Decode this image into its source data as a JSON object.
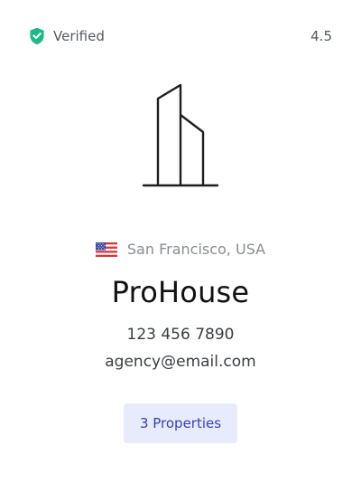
{
  "header": {
    "verified_label": "Verified",
    "verified_icon": "shield-check-icon",
    "rating": "4.5"
  },
  "logo": {
    "icon": "building-icon"
  },
  "location": {
    "flag_icon": "us-flag-icon",
    "text": "San Francisco, USA"
  },
  "agency": {
    "name": "ProHouse",
    "phone": "123 456 7890",
    "email": "agency@email.com"
  },
  "actions": {
    "properties_label": "3 Properties"
  },
  "colors": {
    "verified_green": "#1db98a",
    "button_bg": "#e8ebfc",
    "button_text": "#3343b8",
    "text_muted": "#8a8d92",
    "text_primary": "#111111"
  }
}
